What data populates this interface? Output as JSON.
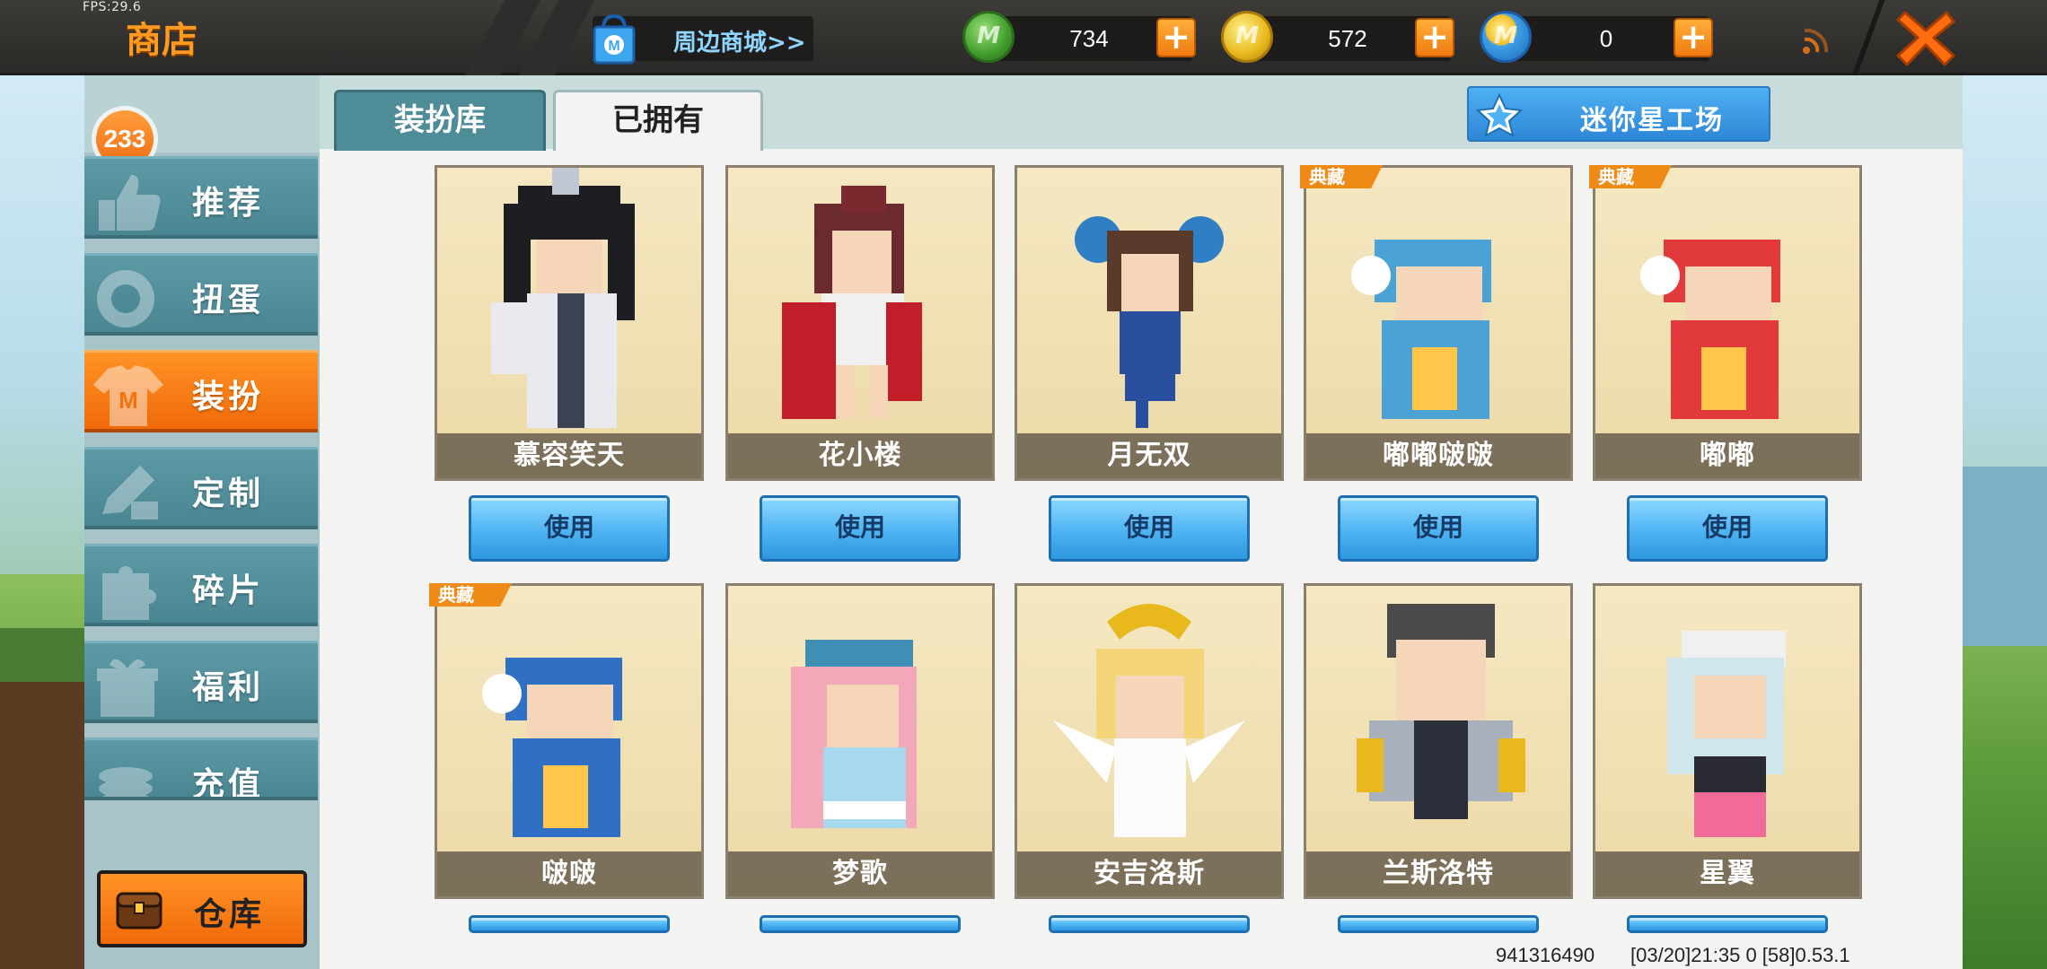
{
  "hud": {
    "fps": "FPS:29.6"
  },
  "header": {
    "title": "商店",
    "mall_link": "周边商城>>",
    "currencies": [
      {
        "name": "green-coin",
        "value": "734",
        "color": "#3f9c2a"
      },
      {
        "name": "gold-coin",
        "value": "572",
        "color": "#e8b81c"
      },
      {
        "name": "blue-coin",
        "value": "0",
        "color": "#1d6bc0"
      }
    ]
  },
  "sidebar": {
    "badge": "233",
    "items": [
      {
        "label": "推荐",
        "icon": "thumbs-up-icon"
      },
      {
        "label": "扭蛋",
        "icon": "capsule-icon"
      },
      {
        "label": "装扮",
        "icon": "shirt-icon",
        "active": true
      },
      {
        "label": "定制",
        "icon": "pencil-icon"
      },
      {
        "label": "碎片",
        "icon": "puzzle-icon"
      },
      {
        "label": "福利",
        "icon": "gift-icon"
      },
      {
        "label": "充值",
        "icon": "coins-icon"
      }
    ],
    "warehouse": "仓库"
  },
  "tabs": [
    {
      "label": "装扮库",
      "active": false
    },
    {
      "label": "已拥有",
      "active": true
    }
  ],
  "workshop_button": "迷你星工场",
  "skins": [
    {
      "name": "慕容笑天",
      "tag": ""
    },
    {
      "name": "花小楼",
      "tag": ""
    },
    {
      "name": "月无双",
      "tag": ""
    },
    {
      "name": "嘟嘟啵啵",
      "tag": "典藏"
    },
    {
      "name": "嘟嘟",
      "tag": "典藏"
    },
    {
      "name": "啵啵",
      "tag": "典藏"
    },
    {
      "name": "梦歌",
      "tag": ""
    },
    {
      "name": "安吉洛斯",
      "tag": ""
    },
    {
      "name": "兰斯洛特",
      "tag": ""
    },
    {
      "name": "星翼",
      "tag": ""
    }
  ],
  "use_label": "使用",
  "footer": {
    "uid": "941316490",
    "build": "[03/20]21:35 0 [58]0.53.1"
  }
}
